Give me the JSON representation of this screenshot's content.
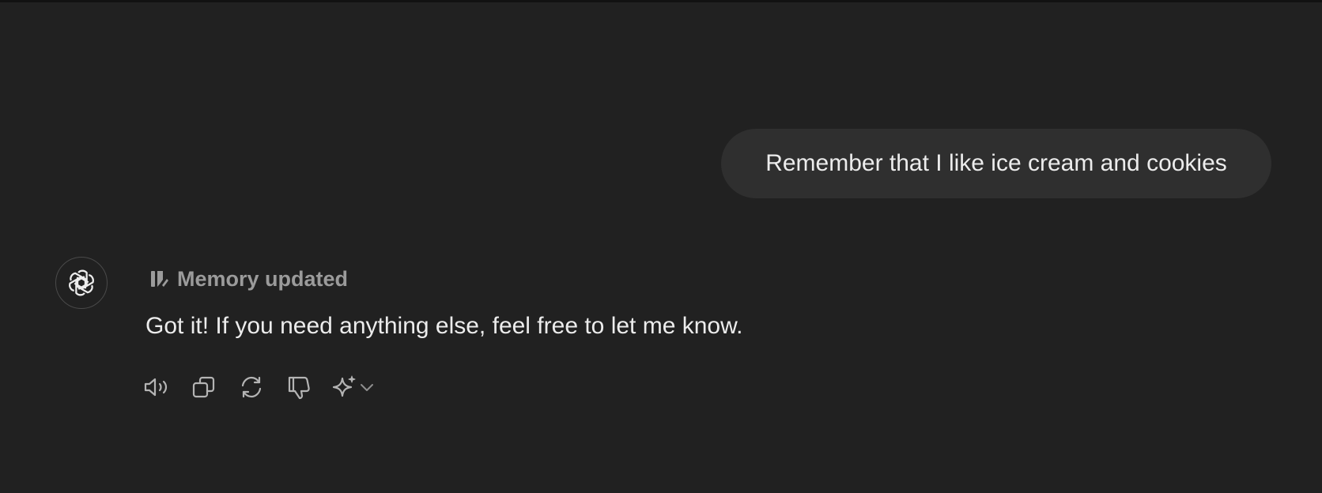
{
  "conversation": {
    "user_message": "Remember that I like ice cream and cookies",
    "assistant": {
      "avatar_icon": "openai-logo-icon",
      "memory_status": "Memory updated",
      "memory_icon": "memory-bookmark-icon",
      "reply": "Got it! If you need anything else, feel free to let me know."
    }
  },
  "actions": [
    {
      "icon": "speaker-read-aloud-icon",
      "label": "Read aloud"
    },
    {
      "icon": "copy-icon",
      "label": "Copy"
    },
    {
      "icon": "regenerate-icon",
      "label": "Regenerate"
    },
    {
      "icon": "thumbs-down-icon",
      "label": "Bad response"
    },
    {
      "icon": "sparkle-model-icon",
      "label": "Switch model"
    }
  ],
  "colors": {
    "background": "#212121",
    "user_bubble": "#2f2f2f",
    "text": "#ececec",
    "muted": "#9b9b9b"
  }
}
